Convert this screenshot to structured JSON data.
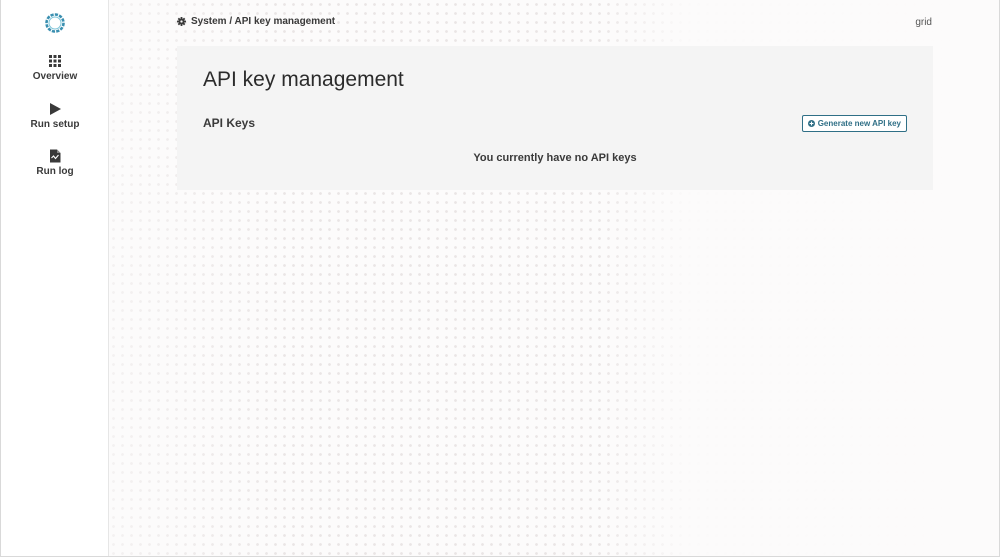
{
  "sidebar": {
    "items": [
      {
        "label": "Overview",
        "icon": "grid-icon"
      },
      {
        "label": "Run setup",
        "icon": "play-icon"
      },
      {
        "label": "Run log",
        "icon": "file-icon"
      }
    ]
  },
  "header": {
    "breadcrumb": "System / API key management",
    "breadcrumb_icon": "gear-icon",
    "user": "grid"
  },
  "main": {
    "title": "API key management",
    "section_title": "API Keys",
    "generate_button_label": "Generate new API key",
    "generate_button_icon": "plus-circle-icon",
    "empty_message": "You currently have no API keys"
  },
  "colors": {
    "accent": "#2f6f86",
    "logo": "#3a8fb0"
  }
}
